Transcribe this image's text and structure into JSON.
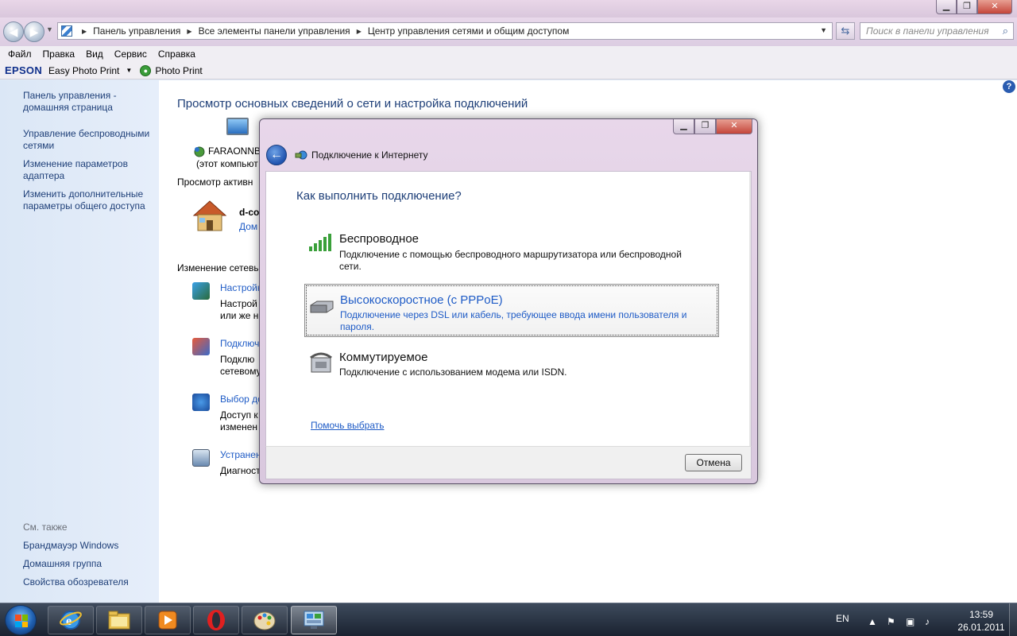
{
  "window": {
    "title": "",
    "search_placeholder": "Поиск в панели управления",
    "breadcrumbs": [
      "Панель управления",
      "Все элементы панели управления",
      "Центр управления сетями и общим доступом"
    ]
  },
  "menu": [
    "Файл",
    "Правка",
    "Вид",
    "Сервис",
    "Справка"
  ],
  "epson": {
    "logo": "EPSON",
    "easy_photo_print": "Easy Photo Print",
    "photo_print": "Photo Print"
  },
  "sidebar": {
    "items": [
      "Панель управления -\nдомашняя страница",
      "Управление беспроводными\nсетями",
      "Изменение параметров\nадаптера",
      "Изменить дополнительные\nпараметры общего доступа"
    ],
    "see_also_label": "См. также",
    "see_also": [
      "Брандмауэр Windows",
      "Домашняя группа",
      "Свойства обозревателя"
    ]
  },
  "main": {
    "title": "Просмотр основных сведений о сети и настройка подключений",
    "computer_name": "FARAONNB",
    "computer_sub": "(этот компьют",
    "active_networks": "Просмотр активн",
    "network_name": "d-co",
    "network_type": "Дом",
    "change_settings": "Изменение сетевы",
    "tasks": [
      {
        "link": "Настройк",
        "desc1": "Настрой",
        "desc2": "или же н"
      },
      {
        "link": "Подключ",
        "desc1": "Подклю",
        "desc2": "сетевому"
      },
      {
        "link": "Выбор до",
        "desc1": "Доступ к",
        "desc2": "изменен"
      },
      {
        "link": "Устранен",
        "desc1": "Диагност",
        "desc2": ""
      }
    ]
  },
  "dialog": {
    "title": "Подключение к Интернету",
    "question": "Как выполнить подключение?",
    "options": [
      {
        "title": "Беспроводное",
        "desc": "Подключение с помощью беспроводного маршрутизатора или беспроводной сети."
      },
      {
        "title": "Высокоскоростное (с PPPoE)",
        "desc": "Подключение через DSL или кабель, требующее ввода имени пользователя и пароля."
      },
      {
        "title": "Коммутируемое",
        "desc": "Подключение с использованием модема или ISDN."
      }
    ],
    "help_link": "Помочь выбрать",
    "cancel": "Отмена"
  },
  "taskbar": {
    "lang": "EN",
    "time": "13:59",
    "date": "26.01.2011"
  },
  "colors": {
    "link": "#1e5bc6",
    "heading": "#1e3f78",
    "sidebar_bg": "#dbe7f6",
    "titlebar": "#e8d7ea"
  }
}
